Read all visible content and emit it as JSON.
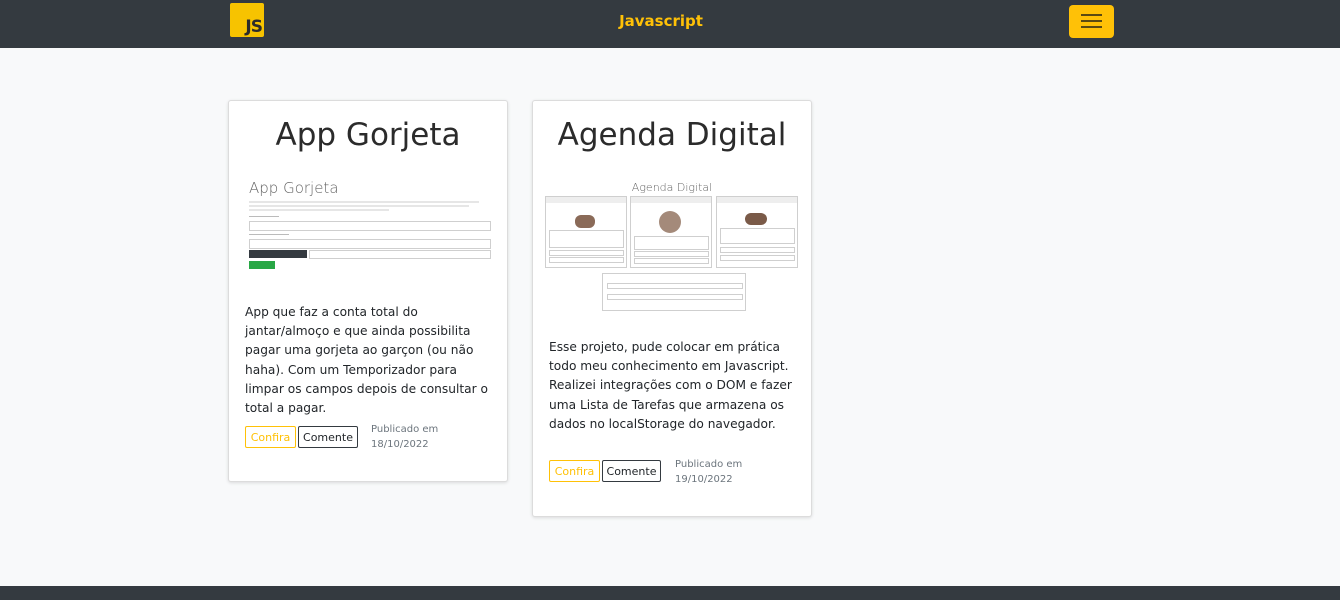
{
  "navbar": {
    "logo_text": "JS",
    "title": "Javascript",
    "menu_icon": "hamburger-icon",
    "colors": {
      "background": "#343a40",
      "accent": "#ffc107",
      "logo": "#f7c300"
    }
  },
  "cards": [
    {
      "title": "App Gorjeta",
      "thumbnail_title": "App Gorjeta",
      "description": "App que faz a conta total do jantar/almoço e que ainda possibilita pagar uma gorjeta ao garçon (ou não haha). Com um Temporizador para limpar os campos depois de consultar o total a pagar.",
      "confira_label": "Confira",
      "comente_label": "Comente",
      "published_label": "Publicado em",
      "published_date": "18/10/2022"
    },
    {
      "title": "Agenda Digital",
      "thumbnail_title": "Agenda Digital",
      "description": "Esse projeto, pude colocar em prática todo meu conhecimento em Javascript. Realizei integrações com o DOM e fazer uma Lista de Tarefas que armazena os dados no localStorage do navegador.",
      "confira_label": "Confira",
      "comente_label": "Comente",
      "published_label": "Publicado em",
      "published_date": "19/10/2022"
    }
  ]
}
